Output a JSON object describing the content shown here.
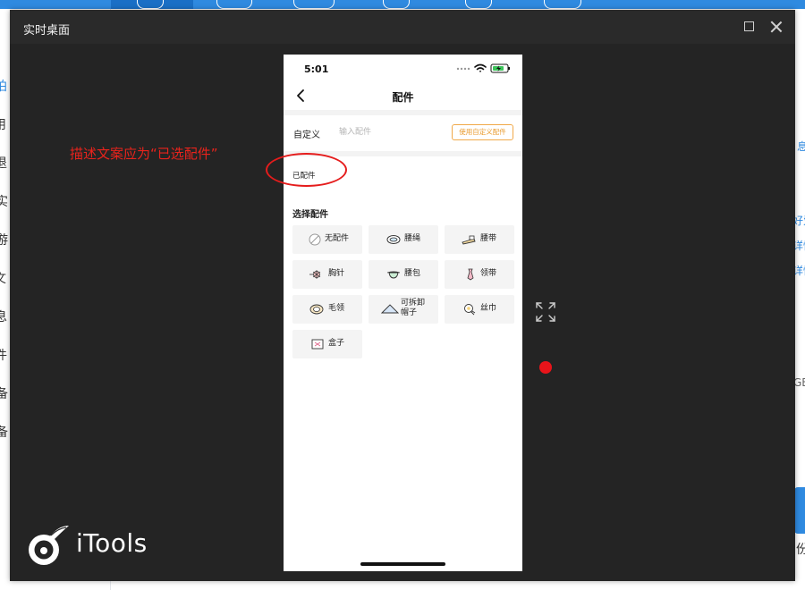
{
  "background_app": {
    "left_items": [
      "拍",
      "用",
      "退",
      "实",
      "游",
      "文",
      "息",
      "件",
      "备",
      "备"
    ],
    "right_items": [
      "息",
      "好爱",
      "详情",
      "详情"
    ],
    "right_storage": "GB",
    "right_bottom": "份"
  },
  "window": {
    "title": "实时桌面",
    "maximize_icon": "square-icon",
    "close_icon": "close-icon"
  },
  "annotation": {
    "text": "描述文案应为“已选配件”",
    "color": "#e8231c"
  },
  "brand": {
    "logo_text": "iTools"
  },
  "phone": {
    "status_time": "5:01",
    "nav_title": "配件",
    "custom": {
      "label": "自定义",
      "input_value": "",
      "input_placeholder": "输入配件",
      "button_label": "使用自定义配件"
    },
    "selected_label": "已配件",
    "choose_title": "选择配件",
    "accessories": [
      {
        "label": "无配件",
        "icon": "none-circle-icon"
      },
      {
        "label": "腰绳",
        "icon": "leash-icon"
      },
      {
        "label": "腰带",
        "icon": "belt-icon"
      },
      {
        "label": "胸针",
        "icon": "brooch-icon"
      },
      {
        "label": "腰包",
        "icon": "waist-bag-icon"
      },
      {
        "label": "领带",
        "icon": "tie-icon"
      },
      {
        "label": "毛领",
        "icon": "fur-collar-icon"
      },
      {
        "label": "可拆卸帽子",
        "icon": "hat-icon"
      },
      {
        "label": "丝巾",
        "icon": "scarf-icon"
      },
      {
        "label": "盒子",
        "icon": "box-icon"
      }
    ]
  },
  "colors": {
    "window_bg": "#242424",
    "accent_orange": "#e99a2c",
    "annotation_red": "#e8231c",
    "brand_blue": "#2f8ae0"
  }
}
